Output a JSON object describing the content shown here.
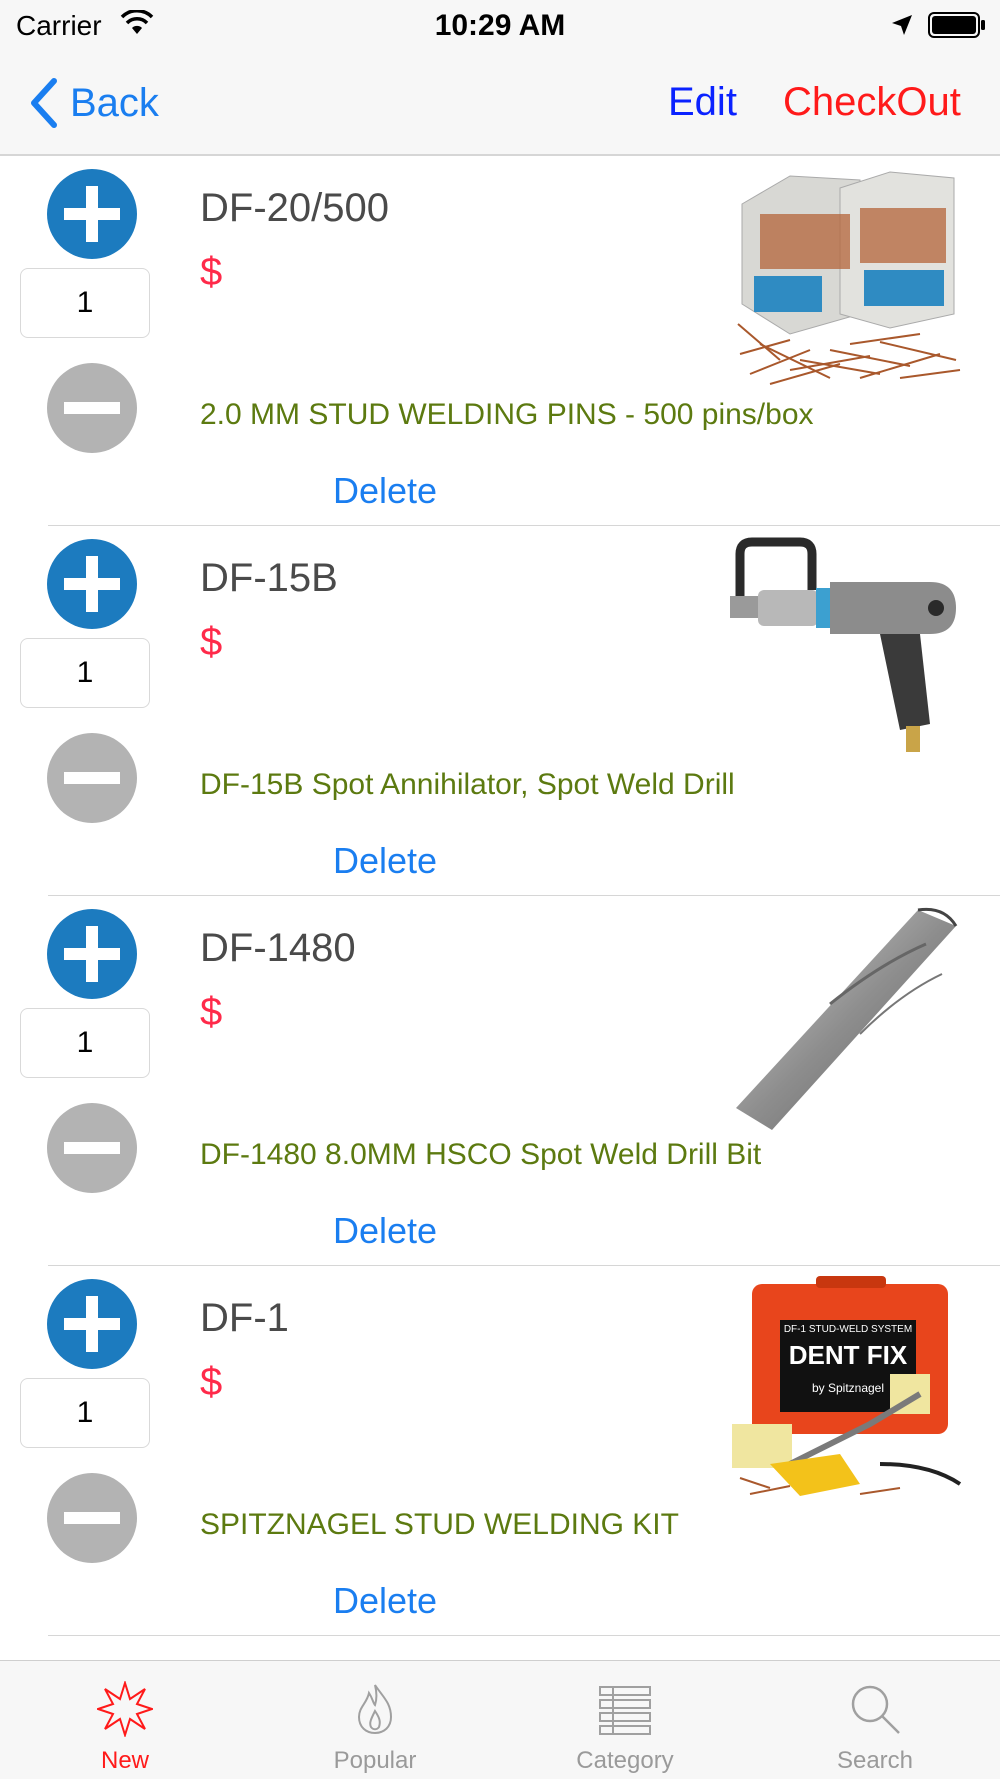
{
  "status_bar": {
    "carrier": "Carrier",
    "time": "10:29 AM"
  },
  "nav": {
    "back_label": "Back",
    "edit_label": "Edit",
    "checkout_label": "CheckOut"
  },
  "cart": {
    "items": [
      {
        "sku": "DF-20/500",
        "price": "$",
        "quantity": "1",
        "description": "2.0 MM STUD WELDING PINS - 500 pins/box",
        "delete_label": "Delete"
      },
      {
        "sku": "DF-15B",
        "price": "$",
        "quantity": "1",
        "description": "DF-15B Spot Annihilator, Spot Weld Drill",
        "delete_label": "Delete"
      },
      {
        "sku": "DF-1480",
        "price": "$",
        "quantity": "1",
        "description": "DF-1480 8.0MM HSCO Spot Weld Drill Bit",
        "delete_label": "Delete"
      },
      {
        "sku": "DF-1",
        "price": "$",
        "quantity": "1",
        "description": "SPITZNAGEL STUD WELDING KIT",
        "delete_label": "Delete",
        "image_text": {
          "title": "DENT FIX",
          "subtitle": "by Spitznagel",
          "label": "DF-1 STUD-WELD SYSTEM"
        }
      }
    ]
  },
  "tab_bar": {
    "tabs": [
      {
        "label": "New",
        "icon": "new-burst-icon",
        "active": true
      },
      {
        "label": "Popular",
        "icon": "flame-icon",
        "active": false
      },
      {
        "label": "Category",
        "icon": "list-icon",
        "active": false
      },
      {
        "label": "Search",
        "icon": "search-icon",
        "active": false
      }
    ]
  },
  "colors": {
    "link_blue": "#1a7ef0",
    "edit_blue": "#0a22ff",
    "checkout_red": "#ff1a1a",
    "price_red": "#ff2a4a",
    "description_green": "#5c7a10",
    "plus_button_blue": "#1c7bbf",
    "minus_button_gray": "#b3b3b3"
  }
}
